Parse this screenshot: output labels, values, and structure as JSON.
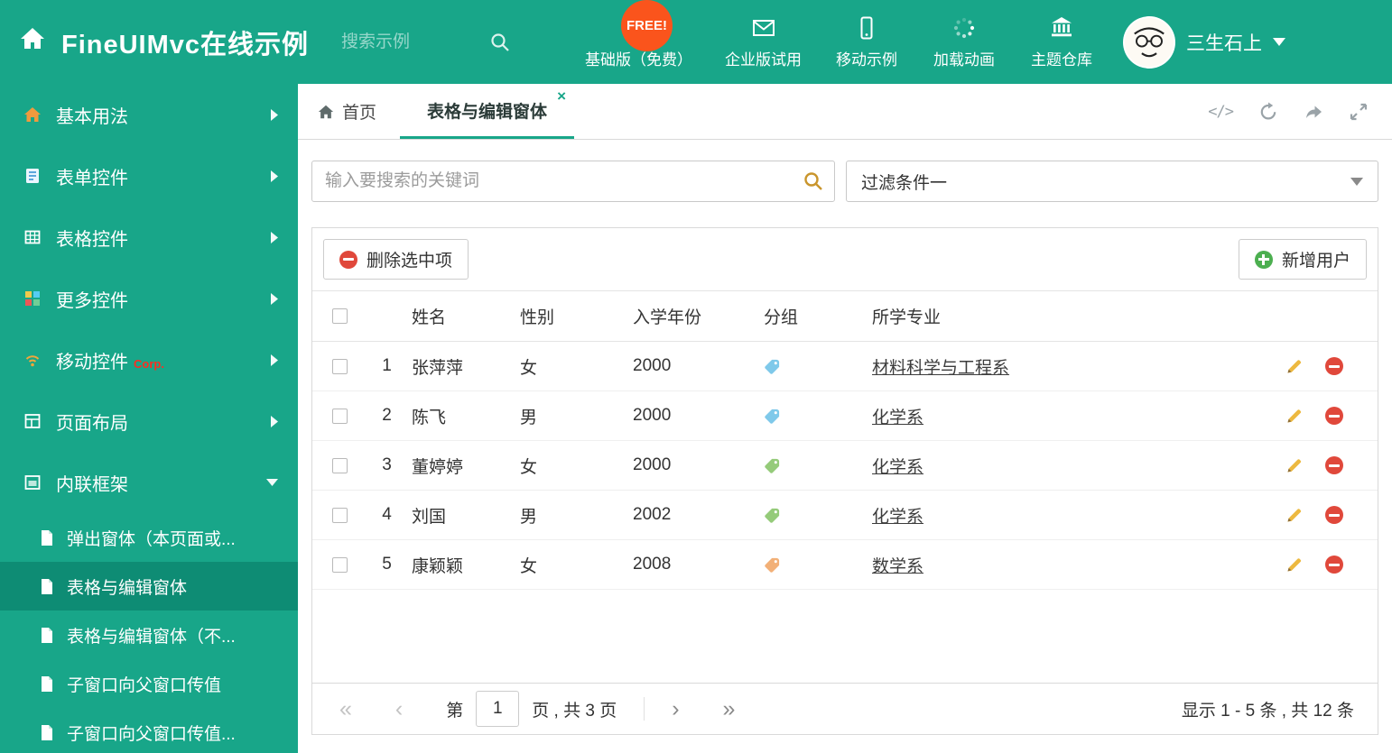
{
  "theme": {
    "primary_green": "#18a689",
    "sidebar_active": "#0e8c74",
    "free_badge_red": "#fa541c",
    "delete_red": "#e0483b",
    "add_green": "#4caf50",
    "edit_yellow": "#edb940"
  },
  "header": {
    "title": "FineUIMvc在线示例",
    "search_placeholder": "搜索示例",
    "free_badge": "FREE!",
    "nav": [
      {
        "label": "基础版（免费）"
      },
      {
        "label": "企业版试用"
      },
      {
        "label": "移动示例"
      },
      {
        "label": "加载动画"
      },
      {
        "label": "主题仓库"
      }
    ],
    "user_name": "三生石上"
  },
  "sidebar": {
    "items": [
      {
        "label": "基本用法"
      },
      {
        "label": "表单控件"
      },
      {
        "label": "表格控件"
      },
      {
        "label": "更多控件"
      },
      {
        "label": "移动控件",
        "badge": "Corp."
      },
      {
        "label": "页面布局"
      },
      {
        "label": "内联框架"
      }
    ],
    "subitems": [
      {
        "label": "弹出窗体（本页面或..."
      },
      {
        "label": "表格与编辑窗体"
      },
      {
        "label": "表格与编辑窗体（不..."
      },
      {
        "label": "子窗口向父窗口传值"
      },
      {
        "label": "子窗口向父窗口传值..."
      }
    ]
  },
  "tabs": {
    "home": "首页",
    "active": "表格与编辑窗体",
    "close_glyph": "×",
    "code_icon_glyph": "</>"
  },
  "filters": {
    "keyword_placeholder": "输入要搜索的关键词",
    "filter_selected": "过滤条件一"
  },
  "grid": {
    "delete_button": "删除选中项",
    "add_button": "新增用户",
    "columns": {
      "name": "姓名",
      "gender": "性别",
      "year": "入学年份",
      "group": "分组",
      "major": "所学专业"
    },
    "rows": [
      {
        "num": "1",
        "name": "张萍萍",
        "gender": "女",
        "year": "2000",
        "tag_color": "#7fc9ea",
        "major": "材料科学与工程系"
      },
      {
        "num": "2",
        "name": "陈飞",
        "gender": "男",
        "year": "2000",
        "tag_color": "#7fc9ea",
        "major": "化学系"
      },
      {
        "num": "3",
        "name": "董婷婷",
        "gender": "女",
        "year": "2000",
        "tag_color": "#95cb7a",
        "major": "化学系"
      },
      {
        "num": "4",
        "name": "刘国",
        "gender": "男",
        "year": "2002",
        "tag_color": "#95cb7a",
        "major": "化学系"
      },
      {
        "num": "5",
        "name": "康颖颖",
        "gender": "女",
        "year": "2008",
        "tag_color": "#f2b077",
        "major": "数学系"
      }
    ]
  },
  "pagination": {
    "first_glyph": "«",
    "prev_glyph": "‹",
    "next_glyph": "›",
    "last_glyph": "»",
    "page_prefix": "第",
    "page": "1",
    "page_suffix": "页 , 共 3 页",
    "summary": "显示 1 - 5 条 , 共 12 条"
  }
}
